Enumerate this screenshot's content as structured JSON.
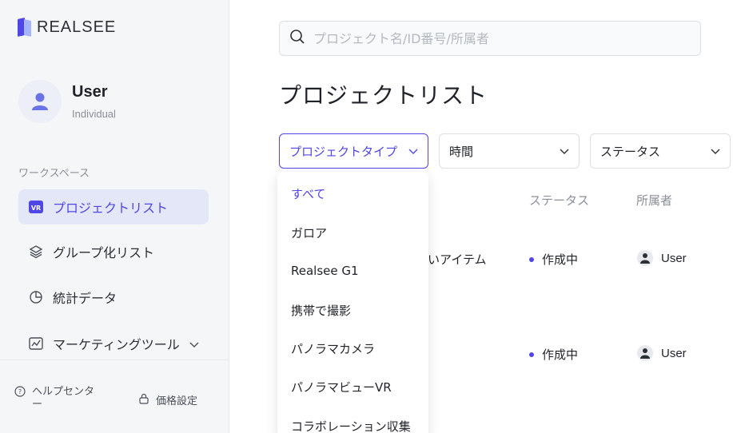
{
  "brand": {
    "name": "REALSEE"
  },
  "user": {
    "name": "User",
    "type": "Individual"
  },
  "sidebar": {
    "section_label": "ワークスペース",
    "items": [
      {
        "label": "プロジェクトリスト",
        "icon": "vr-icon",
        "active": true
      },
      {
        "label": "グループ化リスト",
        "icon": "layers-icon",
        "active": false
      },
      {
        "label": "統計データ",
        "icon": "pie-chart-icon",
        "active": false
      },
      {
        "label": "マーケティングツール",
        "icon": "line-chart-icon",
        "active": false,
        "expandable": true
      }
    ],
    "footer": {
      "help": "ヘルプセンター",
      "pricing": "価格設定"
    }
  },
  "search": {
    "placeholder": "プロジェクト名/ID番号/所属者",
    "value": ""
  },
  "page_title": "プロジェクトリスト",
  "filters": {
    "project_type": "プロジェクトタイプ",
    "time": "時間",
    "status": "ステータス"
  },
  "table": {
    "headers": {
      "status": "ステータス",
      "owner": "所属者"
    },
    "rows": [
      {
        "name_fragment": "ないアイテム",
        "status": "作成中",
        "owner": "User"
      },
      {
        "name_fragment": "",
        "status": "作成中",
        "owner": "User"
      }
    ]
  },
  "dropdown": {
    "options": [
      "すべて",
      "ガロア",
      "Realsee G1",
      "携帯で撮影",
      "パノラマカメラ",
      "パノラマビューVR",
      "コラボレーション収集"
    ],
    "selected_index": 0
  },
  "colors": {
    "accent": "#4f46e5",
    "sidebar_bg": "#f5f6f8",
    "active_bg": "#e4e7f7"
  }
}
